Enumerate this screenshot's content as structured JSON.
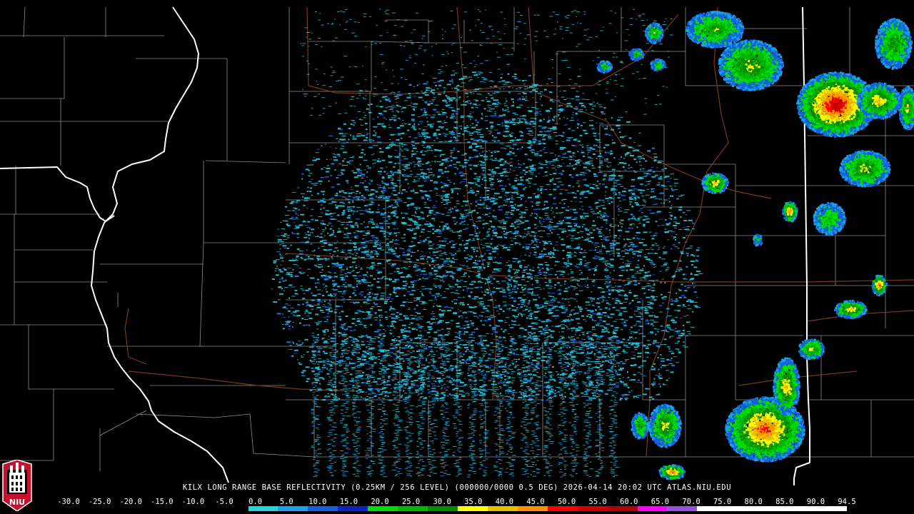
{
  "product_caption": "KILX LONG RANGE BASE REFLECTIVITY (0.25KM / 256 LEVEL) (000000/0000 0.5 DEG) 2026-04-14 20:02 UTC  ATLAS.NIU.EDU",
  "logo_text": "NIU",
  "scale_labels": [
    "-30.0",
    "-25.0",
    "-20.0",
    "-15.0",
    "-10.0",
    "-5.0",
    "0.0",
    "5.0",
    "10.0",
    "15.0",
    "20.0",
    "25.0",
    "30.0",
    "35.0",
    "40.0",
    "45.0",
    "50.0",
    "55.0",
    "60.0",
    "65.0",
    "70.0",
    "75.0",
    "80.0",
    "85.0",
    "90.0",
    "94.5"
  ],
  "colorbar_colors": [
    "#000000",
    "#000000",
    "#000000",
    "#000000",
    "#000000",
    "#000000",
    "#2ad4d4",
    "#1aa4e8",
    "#1460e0",
    "#0a24c8",
    "#00e000",
    "#00b800",
    "#008c00",
    "#ffff00",
    "#e8c000",
    "#ff9000",
    "#ff0000",
    "#d40000",
    "#b40000",
    "#ff00ff",
    "#9a50d8",
    "#ffffff",
    "#ffffff",
    "#ffffff",
    "#ffffff",
    "#ffffff"
  ],
  "background_color": "#000000",
  "state_border_color": "#ffffff",
  "county_line_color": "#8c8c8c",
  "highway_color": "#7a3a18",
  "radar_site_marker": "KILX"
}
